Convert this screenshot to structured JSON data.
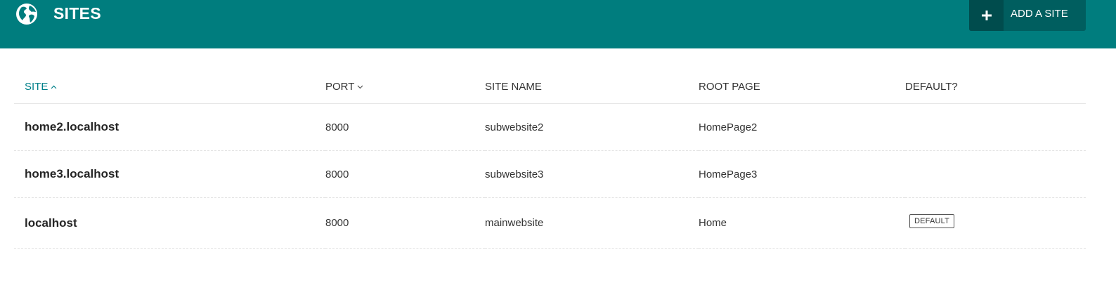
{
  "header": {
    "icon": "globe-icon",
    "title": "SITES",
    "add_button_label": "ADD A SITE",
    "add_button_icon": "plus-icon",
    "background_color": "#007d7e"
  },
  "table": {
    "columns": [
      {
        "label": "SITE",
        "sort": "ascending"
      },
      {
        "label": "PORT",
        "sort": "descending"
      },
      {
        "label": "SITE NAME"
      },
      {
        "label": "ROOT PAGE"
      },
      {
        "label": "DEFAULT?"
      }
    ],
    "rows": [
      {
        "site": "home2.localhost",
        "port": "8000",
        "site_name": "subwebsite2",
        "root_page": "HomePage2",
        "default": ""
      },
      {
        "site": "home3.localhost",
        "port": "8000",
        "site_name": "subwebsite3",
        "root_page": "HomePage3",
        "default": ""
      },
      {
        "site": "localhost",
        "port": "8000",
        "site_name": "mainwebsite",
        "root_page": "Home",
        "default": "DEFAULT"
      }
    ]
  }
}
